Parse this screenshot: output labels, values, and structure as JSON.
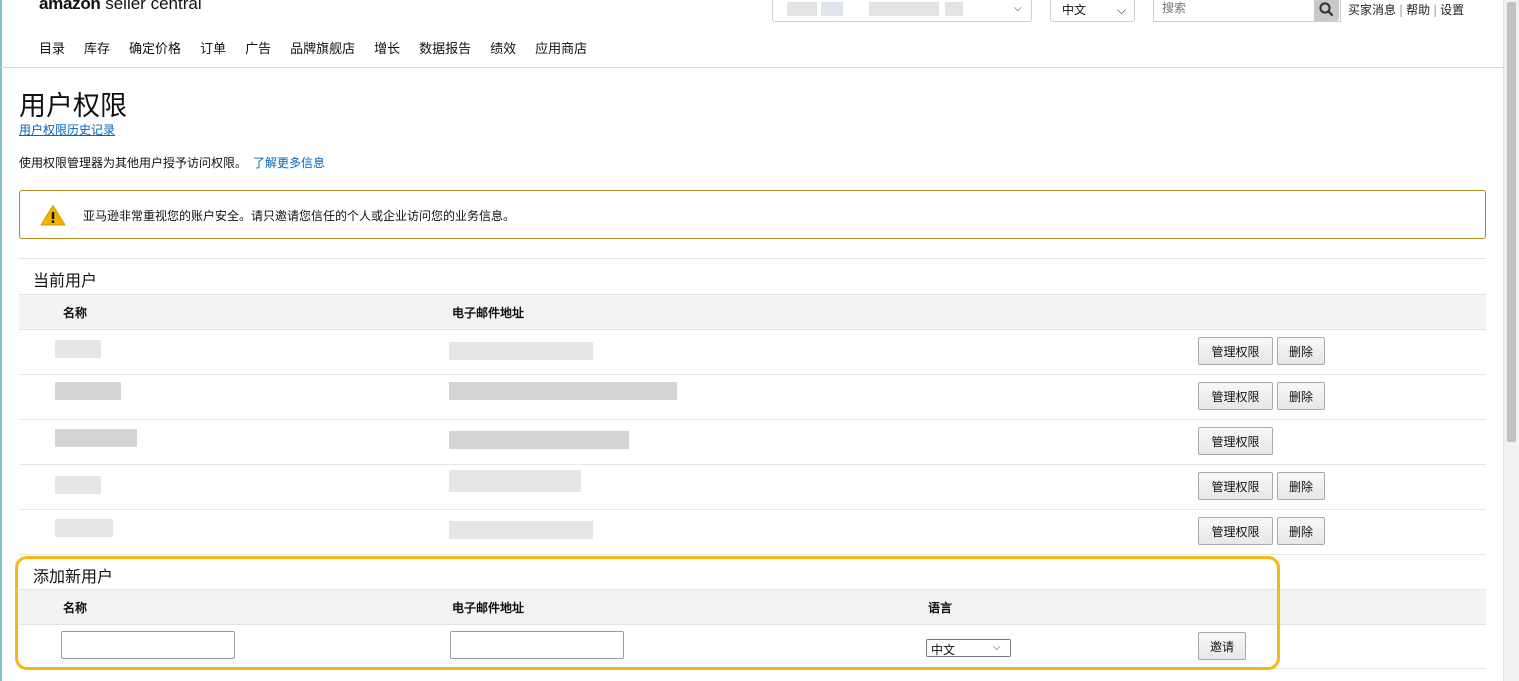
{
  "header": {
    "logo_bold": "amazon",
    "logo_rest": " seller central",
    "language": "中文",
    "search_placeholder": "搜索",
    "links": [
      "买家消息",
      "帮助",
      "设置"
    ]
  },
  "nav": [
    "目录",
    "库存",
    "确定价格",
    "订单",
    "广告",
    "品牌旗舰店",
    "增长",
    "数据报告",
    "绩效",
    "应用商店"
  ],
  "page": {
    "title": "用户权限",
    "history_link": "用户权限历史记录",
    "intro": "使用权限管理器为其他用户授予访问权限。",
    "learn_more": "了解更多信息",
    "alert": "亚马逊非常重视您的账户安全。请只邀请您信任的个人或企业访问您的业务信息。"
  },
  "current_users": {
    "title": "当前用户",
    "col_name": "名称",
    "col_email": "电子邮件地址",
    "manage_label": "管理权限",
    "delete_label": "删除"
  },
  "add_user": {
    "title": "添加新用户",
    "col_name": "名称",
    "col_email": "电子邮件地址",
    "col_lang": "语言",
    "lang_value": "中文",
    "invite_label": "邀请"
  },
  "colors": {
    "link": "#0066c0",
    "highlight": "#f5b818",
    "alert_border": "#b08a1c"
  }
}
